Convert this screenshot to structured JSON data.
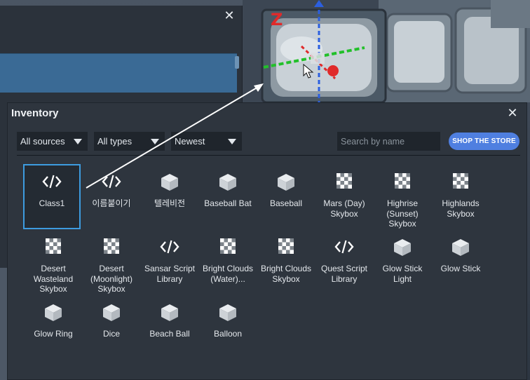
{
  "background_window": {
    "close_icon": "close-icon"
  },
  "inventory": {
    "title": "Inventory",
    "filters": {
      "sources": "All sources",
      "types": "All types",
      "sort": "Newest"
    },
    "search_placeholder": "Search by name",
    "shop_label": "SHOP THE STORE",
    "selected_item": "Class1",
    "items": [
      {
        "label": "Class1",
        "icon": "code-icon"
      },
      {
        "label": "이름붙이기",
        "icon": "code-icon"
      },
      {
        "label": "텔레비전",
        "icon": "cube-icon"
      },
      {
        "label": "Baseball Bat",
        "icon": "cube-icon"
      },
      {
        "label": "Baseball",
        "icon": "cube-icon"
      },
      {
        "label": "Mars (Day) Skybox",
        "icon": "checker-icon"
      },
      {
        "label": "Highrise (Sunset) Skybox",
        "icon": "checker-icon"
      },
      {
        "label": "Highlands Skybox",
        "icon": "checker-icon"
      },
      {
        "label": "Desert Wasteland Skybox",
        "icon": "checker-icon"
      },
      {
        "label": "Desert (Moonlight) Skybox",
        "icon": "checker-icon"
      },
      {
        "label": "Sansar Script Library",
        "icon": "code-icon"
      },
      {
        "label": "Bright Clouds (Water)...",
        "icon": "checker-icon"
      },
      {
        "label": "Bright Clouds Skybox",
        "icon": "checker-icon"
      },
      {
        "label": "Quest Script Library",
        "icon": "code-icon"
      },
      {
        "label": "Glow Stick Light",
        "icon": "cube-icon"
      },
      {
        "label": "Glow Stick",
        "icon": "cube-icon"
      },
      {
        "label": "Glow Ring",
        "icon": "cube-icon"
      },
      {
        "label": "Dice",
        "icon": "cube-icon"
      },
      {
        "label": "Beach Ball",
        "icon": "cube-icon"
      },
      {
        "label": "Balloon",
        "icon": "cube-icon"
      }
    ]
  },
  "colors": {
    "accent": "#4f7fe0",
    "selection": "#3d9ce0",
    "gizmo_x": "#22c02a",
    "gizmo_y": "#2b5fe0",
    "gizmo_z": "#e02a2a"
  }
}
